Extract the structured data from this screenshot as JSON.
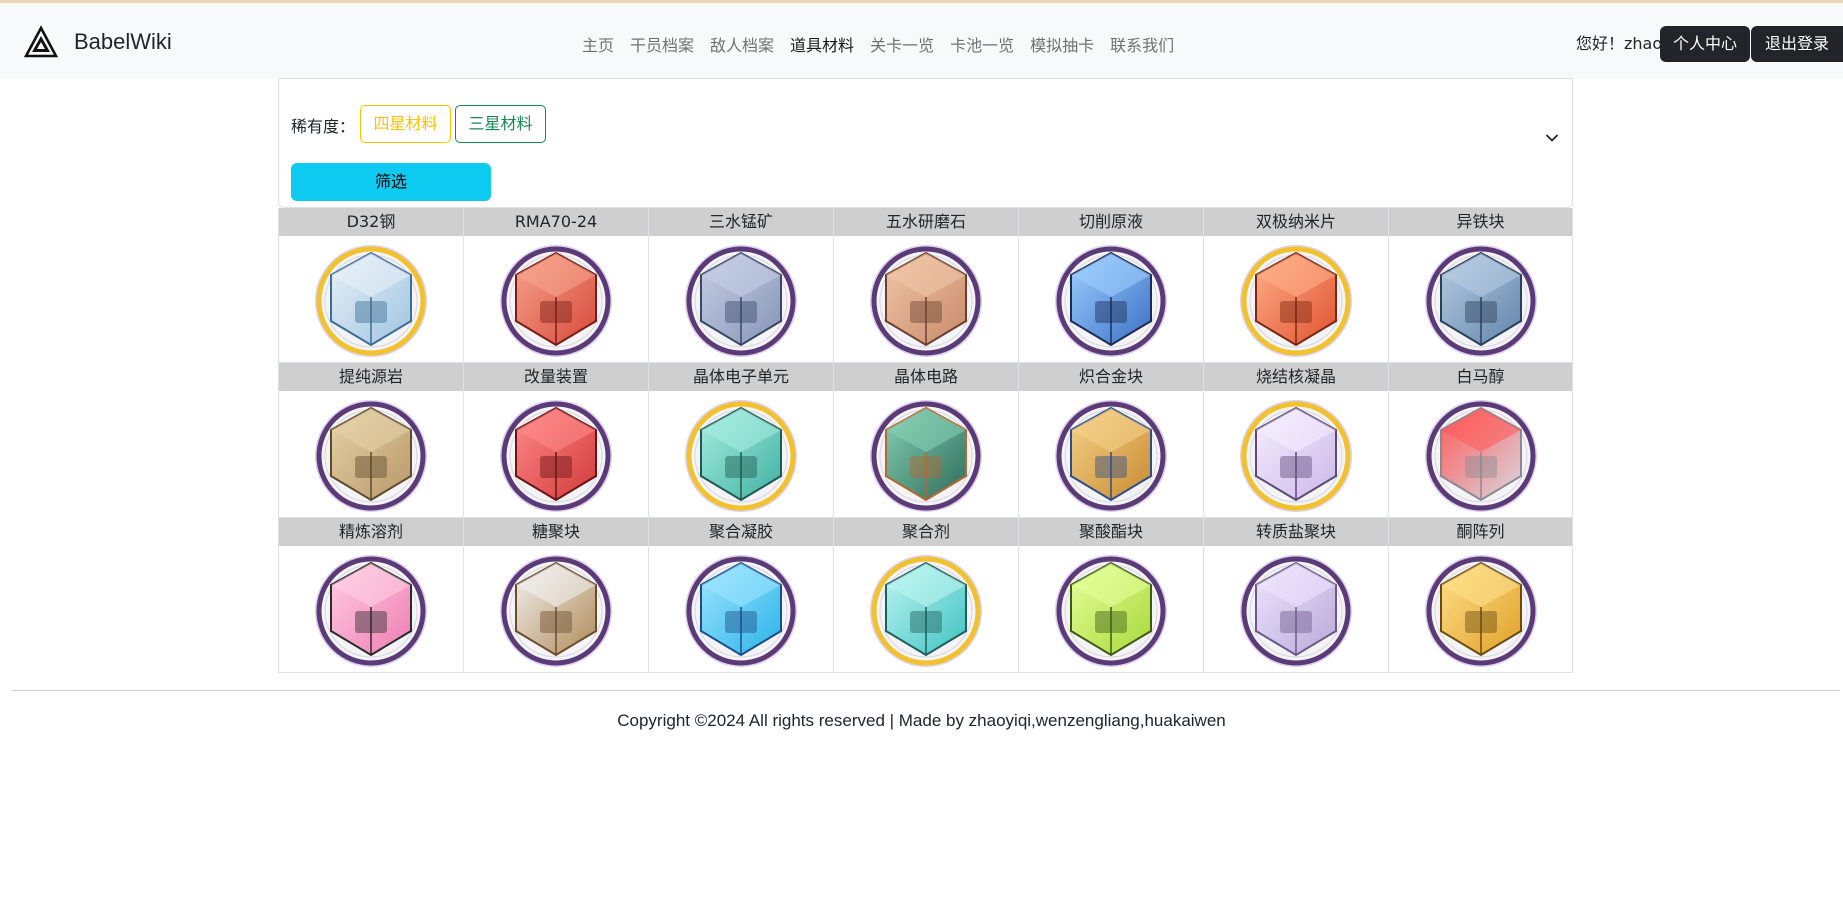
{
  "brand": {
    "name": "BabelWiki",
    "logo_icon": "triangle-logo-icon"
  },
  "nav": [
    {
      "label": "主页",
      "active": false
    },
    {
      "label": "干员档案",
      "active": false
    },
    {
      "label": "敌人档案",
      "active": false
    },
    {
      "label": "道具材料",
      "active": true
    },
    {
      "label": "关卡一览",
      "active": false
    },
    {
      "label": "卡池一览",
      "active": false
    },
    {
      "label": "模拟抽卡",
      "active": false
    },
    {
      "label": "联系我们",
      "active": false
    }
  ],
  "user": {
    "greeting": "您好！zhaoyiqi",
    "profile_button": "个人中心",
    "logout_button": "退出登录"
  },
  "filter": {
    "rarity_label": "稀有度：",
    "chips": [
      {
        "label": "四星材料",
        "color": "#ffc107"
      },
      {
        "label": "三星材料",
        "color": "#198754"
      }
    ],
    "submit_label": "筛选",
    "collapse_icon": "chevron-down-icon"
  },
  "items": [
    [
      {
        "name": "D32钢",
        "ring": "gold",
        "icon": "d32-steel-icon"
      },
      {
        "name": "RMA70-24",
        "ring": "purple",
        "icon": "rma70-24-icon"
      },
      {
        "name": "三水锰矿",
        "ring": "purple",
        "icon": "manganese-trihydrate-icon"
      },
      {
        "name": "五水研磨石",
        "ring": "purple",
        "icon": "grindstone-pentahydrate-icon"
      },
      {
        "name": "切削原液",
        "ring": "purple",
        "icon": "cutting-stock-solution-icon"
      },
      {
        "name": "双极纳米片",
        "ring": "gold",
        "icon": "bipolar-nanoflake-icon"
      },
      {
        "name": "异铁块",
        "ring": "purple",
        "icon": "oriron-block-icon"
      }
    ],
    [
      {
        "name": "提纯源岩",
        "ring": "purple",
        "icon": "orirock-concentration-icon"
      },
      {
        "name": "改量装置",
        "ring": "purple",
        "icon": "optimized-device-icon"
      },
      {
        "name": "晶体电子单元",
        "ring": "gold",
        "icon": "crystalline-electronic-unit-icon"
      },
      {
        "name": "晶体电路",
        "ring": "purple",
        "icon": "crystalline-circuit-icon"
      },
      {
        "name": "炽合金块",
        "ring": "purple",
        "icon": "incandescent-alloy-block-icon"
      },
      {
        "name": "烧结核凝晶",
        "ring": "gold",
        "icon": "nucleic-crystal-sinter-icon"
      },
      {
        "name": "白马醇",
        "ring": "purple",
        "icon": "white-horse-kohl-icon"
      }
    ],
    [
      {
        "name": "精炼溶剂",
        "ring": "purple",
        "icon": "refined-solvent-icon"
      },
      {
        "name": "糖聚块",
        "ring": "purple",
        "icon": "sugar-lump-icon"
      },
      {
        "name": "聚合凝胶",
        "ring": "purple",
        "icon": "polymerized-gel-icon"
      },
      {
        "name": "聚合剂",
        "ring": "gold",
        "icon": "polymerization-preparation-icon"
      },
      {
        "name": "聚酸酯块",
        "ring": "purple",
        "icon": "polyester-lump-icon"
      },
      {
        "name": "转质盐聚块",
        "ring": "purple",
        "icon": "transmuted-salt-agglomerate-icon"
      },
      {
        "name": "酮阵列",
        "ring": "purple",
        "icon": "keton-colloid-icon"
      }
    ]
  ],
  "footer": {
    "copyright": "Copyright ©2024 All rights reserved | Made by zhaoyiqi,wenzengliang,huakaiwen"
  },
  "colors": {
    "ring_gold": "#f2c12e",
    "ring_purple": "#5b3a78",
    "cyan_button": "#0dcaf0",
    "dark_button": "#212529"
  }
}
